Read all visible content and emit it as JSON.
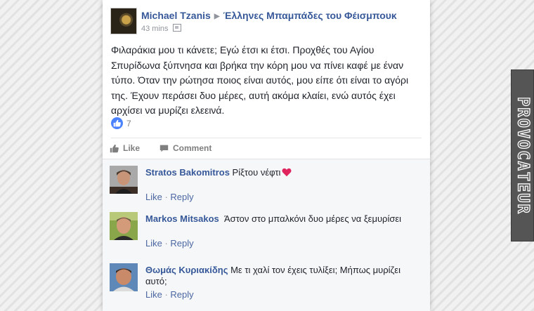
{
  "post": {
    "author": "Michael Tzanis",
    "group": "Έλληνες Μπαμπάδες του Φέισμπουκ",
    "time": "43 mins",
    "text": "Φιλαράκια μου τι κάνετε; Εγώ έτσι κι έτσι. Προχθές του Αγίου Σπυρίδωνα ξύπνησα και βρήκα την κόρη μου να πίνει καφέ με έναν τύπο. Όταν την ρώτησα ποιος είναι αυτός, μου είπε ότι είναι το αγόρι της. Έχουν περάσει δυο μέρες, αυτή ακόμα κλαίει, ενώ αυτός έχει αρχίσει να μυρίζει ελεεινά.",
    "reaction_count": "7",
    "like_label": "Like",
    "comment_label": "Comment"
  },
  "comments": [
    {
      "name": "Stratos Bakomitros",
      "text": "Ρίξτου νέφτι",
      "like": "Like",
      "reply": "Reply"
    },
    {
      "name": "Markos Mitsakos",
      "text": "Άστον στο μπαλκόνι δυο μέρες να ξεμυρίσει",
      "like": "Like",
      "reply": "Reply"
    },
    {
      "name": "Θωμάς Κυριακίδης",
      "text": "Με τι χαλί τον έχεις τυλίξει; Μήπως μυρίζει αυτό;",
      "like": "Like",
      "reply": "Reply"
    }
  ],
  "watermark": "PROVOCATEUR",
  "colors": {
    "link": "#365899",
    "like_blue": "#4b82ff",
    "heart": "#e0245e"
  }
}
